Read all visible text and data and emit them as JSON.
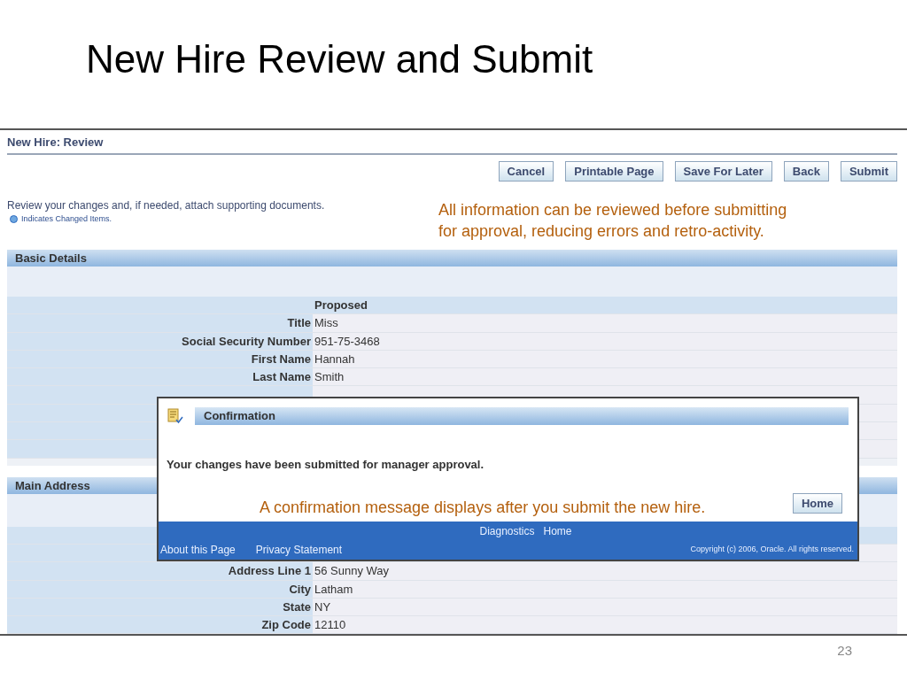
{
  "slide": {
    "title": "New Hire Review and Submit",
    "number": "23"
  },
  "page": {
    "title": "New Hire: Review",
    "buttons": [
      "Cancel",
      "Printable Page",
      "Save For Later",
      "Back",
      "Submit"
    ],
    "instruction": "Review your changes and, if needed, attach supporting documents.",
    "legend": "Indicates Changed Items.",
    "callout": [
      "All information can be reviewed before submitting",
      "for approval, reducing errors and retro-activity."
    ]
  },
  "sections": [
    {
      "title": "Basic Details",
      "column_header": "Proposed",
      "rows": [
        {
          "label": "Title",
          "value": "Miss"
        },
        {
          "label": "Social Security Number",
          "value": "951-75-3468"
        },
        {
          "label": "First Name",
          "value": "Hannah"
        },
        {
          "label": "Last Name",
          "value": "Smith"
        }
      ]
    },
    {
      "title": "Main Address",
      "rows": [
        {
          "label": "Address Line 1",
          "value": "56 Sunny Way"
        },
        {
          "label": "City",
          "value": "Latham"
        },
        {
          "label": "State",
          "value": "NY"
        },
        {
          "label": "Zip Code",
          "value": "12110"
        }
      ]
    }
  ],
  "dialog": {
    "title": "Confirmation",
    "message": "Your changes have been submitted for manager approval.",
    "callout": "A confirmation message displays after you submit the new hire.",
    "button": "Home",
    "footer_links": [
      "Diagnostics",
      "Home"
    ],
    "footer_left": [
      "About this Page",
      "Privacy Statement"
    ],
    "copyright": "Copyright (c) 2006, Oracle. All rights reserved."
  }
}
